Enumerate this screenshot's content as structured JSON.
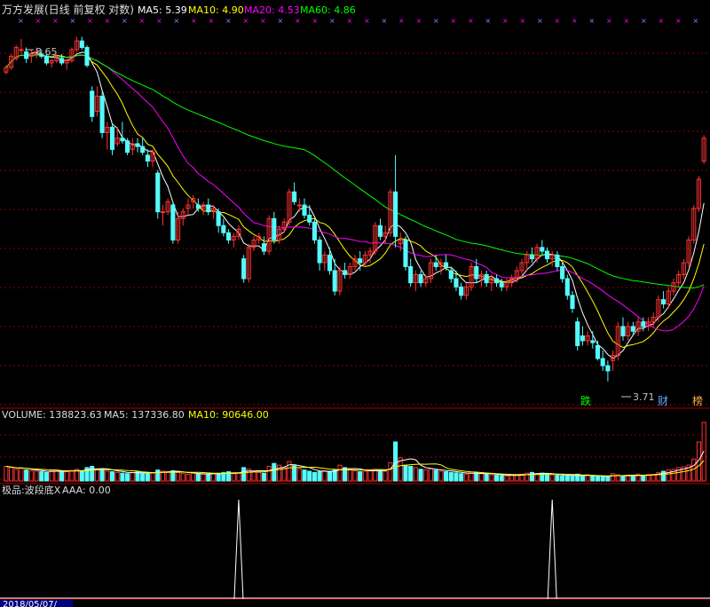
{
  "colors": {
    "up": "#ff3232",
    "down": "#54fcfc",
    "ma5": "#ffffff",
    "ma10": "#ffff00",
    "ma20": "#ff00ff",
    "ma60": "#00ff00",
    "grid": "#8b0000",
    "label": "#c0c0c0"
  },
  "header": {
    "title": "万方发展(日线 前复权 对数)",
    "ma5_label": "MA5: 5.39",
    "ma10_label": "MA10: 4.90",
    "ma20_label": "MA20: 4.53",
    "ma60_label": "MA60: 4.86"
  },
  "volume_header": {
    "title": "VOLUME: 138823.63",
    "ma5_label": "MA5: 137336.80",
    "ma10_label": "MA10: 90646.00"
  },
  "indicator_header": {
    "title": "极品:波段底X",
    "aaa_label": "AAA: 0.00"
  },
  "annotations": {
    "high_label": "8.65",
    "low_label": "3.71"
  },
  "markers": [
    {
      "text": "跌",
      "color": "#00ff00"
    },
    {
      "text": "财",
      "color": "#5fa8ff"
    },
    {
      "text": "榜",
      "color": "#ffb040"
    }
  ],
  "date_label": "2018/05/07/",
  "chart_data": {
    "type": "candlestick",
    "ohlc": [
      [
        7.9,
        8.05,
        7.85,
        8.0
      ],
      [
        8.0,
        8.3,
        7.95,
        8.25
      ],
      [
        8.2,
        8.5,
        8.15,
        8.45
      ],
      [
        8.4,
        8.65,
        8.3,
        8.4
      ],
      [
        8.35,
        8.45,
        8.1,
        8.2
      ],
      [
        8.25,
        8.4,
        8.1,
        8.3
      ],
      [
        8.3,
        8.45,
        8.2,
        8.35
      ],
      [
        8.3,
        8.4,
        8.2,
        8.25
      ],
      [
        8.25,
        8.3,
        8.05,
        8.1
      ],
      [
        8.1,
        8.2,
        8.0,
        8.15
      ],
      [
        8.15,
        8.3,
        8.1,
        8.25
      ],
      [
        8.2,
        8.3,
        8.05,
        8.1
      ],
      [
        8.1,
        8.2,
        7.95,
        8.15
      ],
      [
        8.15,
        8.45,
        8.1,
        8.4
      ],
      [
        8.4,
        8.7,
        8.35,
        8.6
      ],
      [
        8.6,
        8.7,
        8.4,
        8.45
      ],
      [
        8.45,
        8.5,
        8.0,
        8.05
      ],
      [
        7.5,
        7.6,
        6.9,
        7.0
      ],
      [
        7.1,
        7.6,
        7.0,
        7.4
      ],
      [
        7.4,
        7.5,
        6.6,
        6.7
      ],
      [
        6.7,
        6.9,
        6.4,
        6.8
      ],
      [
        6.8,
        6.85,
        6.3,
        6.4
      ],
      [
        6.5,
        6.8,
        6.45,
        6.6
      ],
      [
        6.6,
        6.9,
        6.5,
        6.55
      ],
      [
        6.55,
        6.6,
        6.3,
        6.35
      ],
      [
        6.4,
        6.6,
        6.3,
        6.5
      ],
      [
        6.5,
        6.6,
        6.35,
        6.45
      ],
      [
        6.45,
        6.6,
        6.3,
        6.35
      ],
      [
        6.3,
        6.4,
        6.1,
        6.2
      ],
      [
        6.2,
        6.4,
        6.1,
        6.35
      ],
      [
        6.0,
        6.05,
        5.3,
        5.4
      ],
      [
        5.4,
        5.5,
        5.2,
        5.4
      ],
      [
        5.4,
        5.6,
        5.35,
        5.55
      ],
      [
        5.5,
        5.55,
        4.95,
        5.0
      ],
      [
        5.0,
        5.4,
        4.95,
        5.3
      ],
      [
        5.3,
        5.45,
        5.2,
        5.4
      ],
      [
        5.45,
        5.6,
        5.35,
        5.5
      ],
      [
        5.55,
        5.65,
        5.45,
        5.6
      ],
      [
        5.5,
        5.6,
        5.4,
        5.45
      ],
      [
        5.45,
        5.55,
        5.35,
        5.5
      ],
      [
        5.5,
        5.6,
        5.35,
        5.4
      ],
      [
        5.4,
        5.5,
        5.3,
        5.45
      ],
      [
        5.4,
        5.45,
        5.1,
        5.2
      ],
      [
        5.2,
        5.3,
        5.05,
        5.1
      ],
      [
        5.1,
        5.15,
        4.95,
        5.0
      ],
      [
        5.0,
        5.1,
        4.9,
        5.05
      ],
      [
        5.05,
        5.2,
        5.0,
        5.15
      ],
      [
        4.75,
        4.8,
        4.45,
        4.5
      ],
      [
        4.5,
        4.95,
        4.45,
        4.9
      ],
      [
        4.9,
        5.05,
        4.85,
        5.0
      ],
      [
        5.0,
        5.1,
        4.95,
        5.05
      ],
      [
        4.95,
        5.05,
        4.8,
        4.85
      ],
      [
        4.85,
        5.35,
        4.8,
        5.3
      ],
      [
        5.3,
        5.4,
        4.95,
        5.0
      ],
      [
        5.0,
        5.2,
        4.95,
        5.15
      ],
      [
        5.15,
        5.3,
        5.1,
        5.25
      ],
      [
        5.25,
        5.75,
        5.2,
        5.7
      ],
      [
        5.7,
        5.85,
        5.5,
        5.55
      ],
      [
        5.5,
        5.6,
        5.4,
        5.5
      ],
      [
        5.5,
        5.6,
        5.3,
        5.35
      ],
      [
        5.35,
        5.5,
        5.2,
        5.25
      ],
      [
        5.25,
        5.3,
        4.95,
        5.0
      ],
      [
        5.0,
        5.05,
        4.6,
        4.7
      ],
      [
        4.7,
        4.85,
        4.6,
        4.8
      ],
      [
        4.8,
        4.9,
        4.55,
        4.6
      ],
      [
        4.6,
        4.75,
        4.3,
        4.35
      ],
      [
        4.35,
        4.65,
        4.3,
        4.6
      ],
      [
        4.6,
        4.7,
        4.5,
        4.55
      ],
      [
        4.55,
        4.7,
        4.5,
        4.65
      ],
      [
        4.65,
        4.8,
        4.6,
        4.75
      ],
      [
        4.75,
        4.85,
        4.6,
        4.7
      ],
      [
        4.7,
        4.85,
        4.65,
        4.8
      ],
      [
        4.8,
        4.9,
        4.7,
        4.85
      ],
      [
        4.85,
        5.25,
        4.8,
        5.2
      ],
      [
        5.2,
        5.3,
        5.0,
        5.05
      ],
      [
        5.05,
        5.2,
        4.95,
        5.1
      ],
      [
        5.1,
        5.75,
        5.05,
        5.7
      ],
      [
        5.7,
        6.3,
        4.9,
        5.05
      ],
      [
        4.95,
        5.1,
        4.85,
        5.0
      ],
      [
        5.0,
        5.05,
        4.6,
        4.65
      ],
      [
        4.65,
        4.75,
        4.4,
        4.45
      ],
      [
        4.45,
        4.6,
        4.35,
        4.55
      ],
      [
        4.55,
        4.6,
        4.4,
        4.45
      ],
      [
        4.45,
        4.55,
        4.4,
        4.5
      ],
      [
        4.5,
        4.75,
        4.45,
        4.7
      ],
      [
        4.7,
        4.8,
        4.6,
        4.65
      ],
      [
        4.65,
        4.75,
        4.55,
        4.7
      ],
      [
        4.7,
        4.8,
        4.6,
        4.65
      ],
      [
        4.6,
        4.65,
        4.45,
        4.5
      ],
      [
        4.5,
        4.6,
        4.35,
        4.4
      ],
      [
        4.4,
        4.45,
        4.25,
        4.3
      ],
      [
        4.3,
        4.45,
        4.25,
        4.4
      ],
      [
        4.4,
        4.7,
        4.35,
        4.65
      ],
      [
        4.65,
        4.75,
        4.45,
        4.5
      ],
      [
        4.5,
        4.6,
        4.4,
        4.55
      ],
      [
        4.55,
        4.6,
        4.4,
        4.45
      ],
      [
        4.45,
        4.55,
        4.35,
        4.5
      ],
      [
        4.5,
        4.55,
        4.4,
        4.45
      ],
      [
        4.45,
        4.5,
        4.35,
        4.4
      ],
      [
        4.4,
        4.5,
        4.35,
        4.45
      ],
      [
        4.45,
        4.55,
        4.4,
        4.5
      ],
      [
        4.5,
        4.65,
        4.45,
        4.6
      ],
      [
        4.6,
        4.75,
        4.55,
        4.7
      ],
      [
        4.7,
        4.85,
        4.6,
        4.8
      ],
      [
        4.8,
        4.9,
        4.7,
        4.75
      ],
      [
        4.75,
        4.95,
        4.7,
        4.9
      ],
      [
        4.9,
        5.0,
        4.8,
        4.85
      ],
      [
        4.85,
        4.9,
        4.7,
        4.75
      ],
      [
        4.75,
        4.85,
        4.65,
        4.8
      ],
      [
        4.8,
        4.85,
        4.6,
        4.65
      ],
      [
        4.65,
        4.7,
        4.45,
        4.5
      ],
      [
        4.5,
        4.55,
        4.25,
        4.3
      ],
      [
        4.3,
        4.35,
        4.1,
        4.15
      ],
      [
        4.0,
        4.05,
        3.7,
        3.75
      ],
      [
        3.85,
        3.95,
        3.75,
        3.8
      ],
      [
        3.8,
        3.9,
        3.75,
        3.85
      ],
      [
        3.8,
        3.9,
        3.72,
        3.78
      ],
      [
        3.75,
        3.8,
        3.6,
        3.62
      ],
      [
        3.62,
        3.7,
        3.5,
        3.55
      ],
      [
        3.55,
        3.6,
        3.4,
        3.5
      ],
      [
        3.6,
        3.7,
        3.5,
        3.65
      ],
      [
        3.65,
        4.0,
        3.6,
        3.95
      ],
      [
        3.95,
        4.05,
        3.8,
        3.85
      ],
      [
        3.85,
        4.0,
        3.8,
        3.95
      ],
      [
        3.95,
        4.0,
        3.85,
        3.9
      ],
      [
        3.9,
        4.05,
        3.85,
        4.0
      ],
      [
        4.0,
        4.05,
        3.9,
        3.95
      ],
      [
        3.95,
        4.05,
        3.9,
        4.0
      ],
      [
        4.0,
        4.1,
        3.95,
        4.05
      ],
      [
        4.05,
        4.3,
        4.0,
        4.25
      ],
      [
        4.25,
        4.35,
        4.15,
        4.2
      ],
      [
        4.2,
        4.4,
        4.15,
        4.35
      ],
      [
        4.35,
        4.5,
        4.3,
        4.45
      ],
      [
        4.45,
        4.6,
        4.4,
        4.55
      ],
      [
        4.55,
        4.75,
        4.5,
        4.7
      ],
      [
        4.7,
        5.05,
        4.65,
        5.0
      ],
      [
        5.0,
        5.5,
        4.95,
        5.45
      ],
      [
        5.45,
        5.95,
        5.4,
        5.9
      ],
      [
        6.2,
        6.65,
        6.15,
        6.6
      ]
    ],
    "volume": [
      60000,
      55000,
      48000,
      52000,
      45000,
      42000,
      40000,
      38000,
      35000,
      42000,
      45000,
      40000,
      38000,
      43000,
      48000,
      42000,
      55000,
      60000,
      45000,
      50000,
      40000,
      38000,
      35000,
      32000,
      30000,
      35000,
      38000,
      33000,
      30000,
      32000,
      45000,
      40000,
      38000,
      42000,
      35000,
      30000,
      28000,
      32000,
      30000,
      27000,
      28000,
      30000,
      32000,
      35000,
      38000,
      30000,
      33000,
      55000,
      48000,
      40000,
      35000,
      32000,
      60000,
      72000,
      65000,
      55000,
      80000,
      62000,
      50000,
      45000,
      40000,
      35000,
      38000,
      42000,
      40000,
      45000,
      65000,
      55000,
      48000,
      42000,
      38000,
      40000,
      42000,
      48000,
      45000,
      40000,
      75000,
      160000,
      95000,
      65000,
      60000,
      55000,
      48000,
      45000,
      50000,
      44000,
      40000,
      38000,
      35000,
      33000,
      30000,
      28000,
      32000,
      35000,
      30000,
      28000,
      25000,
      24000,
      22000,
      21000,
      23000,
      25000,
      28000,
      32000,
      35000,
      30000,
      32000,
      28000,
      25000,
      24000,
      22000,
      20000,
      22000,
      28000,
      18000,
      25000,
      20000,
      18000,
      16000,
      20000,
      30000,
      25000,
      20000,
      23000,
      22000,
      28000,
      24000,
      26000,
      27000,
      35000,
      40000,
      45000,
      48000,
      55000,
      58000,
      65000,
      90000,
      160000,
      240000
    ],
    "signal_spikes_at": [
      46,
      108
    ],
    "high": 8.65,
    "low": 3.71
  }
}
